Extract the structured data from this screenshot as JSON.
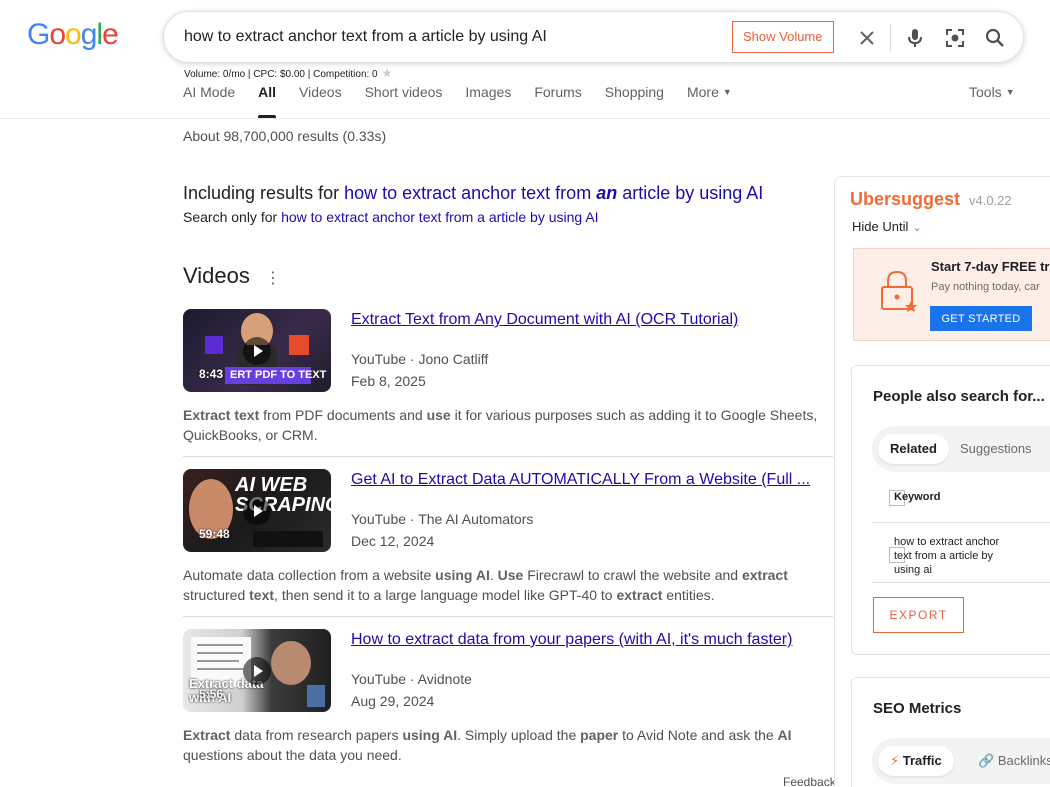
{
  "logo": {
    "letters": [
      "G",
      "o",
      "o",
      "g",
      "l",
      "e"
    ],
    "colors": [
      "#4285f4",
      "#ea4335",
      "#fbbc05",
      "#4285f4",
      "#34a853",
      "#ea4335"
    ]
  },
  "search": {
    "query": "how to extract anchor text from a article by using AI",
    "show_volume_label": "Show Volume",
    "volume_line": "Volume: 0/mo | CPC: $0.00 | Competition: 0",
    "icons": [
      "close-icon",
      "mic-icon",
      "lens-icon",
      "search-icon"
    ]
  },
  "tabs": [
    {
      "label": "AI Mode",
      "active": false
    },
    {
      "label": "All",
      "active": true
    },
    {
      "label": "Videos",
      "active": false
    },
    {
      "label": "Short videos",
      "active": false
    },
    {
      "label": "Images",
      "active": false
    },
    {
      "label": "Forums",
      "active": false
    },
    {
      "label": "Shopping",
      "active": false
    },
    {
      "label": "More",
      "active": false
    }
  ],
  "tools_label": "Tools",
  "stats": "About 98,700,000 results (0.33s)",
  "including": {
    "prefix": "Including results for ",
    "link_before": "how to extract anchor text from ",
    "link_emph": "an",
    "link_after": " article by using AI",
    "search_only_prefix": "Search only for ",
    "search_only_link": "how to extract anchor text from a article by using AI"
  },
  "videos_heading": "Videos",
  "videos": [
    {
      "title": "Extract Text from Any Document with AI (OCR Tutorial)",
      "source": "YouTube · Jono Catliff",
      "date": "Feb 8, 2025",
      "duration": "8:43",
      "thumb_caption": "ERT PDF TO TEXT",
      "desc_parts": [
        {
          "t": "Extract text",
          "b": true
        },
        {
          "t": " from PDF documents and ",
          "b": false
        },
        {
          "t": "use",
          "b": true
        },
        {
          "t": " it for various purposes such as adding it to Google Sheets, QuickBooks, or CRM.",
          "b": false
        }
      ]
    },
    {
      "title": "Get AI to Extract Data AUTOMATICALLY From a Website (Full ...",
      "source": "YouTube · The AI Automators",
      "date": "Dec 12, 2024",
      "duration": "59:48",
      "thumb_caption": "AI WEB SCRAPING",
      "desc_parts": [
        {
          "t": "Automate data collection from a website ",
          "b": false
        },
        {
          "t": "using AI",
          "b": true
        },
        {
          "t": ". ",
          "b": false
        },
        {
          "t": "Use",
          "b": true
        },
        {
          "t": " Firecrawl to crawl the website and ",
          "b": false
        },
        {
          "t": "extract",
          "b": true
        },
        {
          "t": " structured ",
          "b": false
        },
        {
          "t": "text",
          "b": true
        },
        {
          "t": ", then send it to a large language model like GPT-40 to ",
          "b": false
        },
        {
          "t": "extract",
          "b": true
        },
        {
          "t": " entities.",
          "b": false
        }
      ]
    },
    {
      "title": "How to extract data from your papers (with AI, it's much faster)",
      "source": "YouTube · Avidnote",
      "date": "Aug 29, 2024",
      "duration": "5:56",
      "thumb_caption": "Extract data with AI",
      "desc_parts": [
        {
          "t": "Extract",
          "b": true
        },
        {
          "t": " data from research papers ",
          "b": false
        },
        {
          "t": "using AI",
          "b": true
        },
        {
          "t": ". Simply upload the ",
          "b": false
        },
        {
          "t": "paper",
          "b": true
        },
        {
          "t": " to Avid Note and ask the ",
          "b": false
        },
        {
          "t": "AI",
          "b": true
        },
        {
          "t": " questions about the data you need.",
          "b": false
        }
      ]
    }
  ],
  "feedback": "Feedback",
  "ubersuggest": {
    "title": "Ubersuggest",
    "version": "v4.0.22",
    "hide_until": "Hide Until",
    "promo_title": "Start 7-day FREE tr",
    "promo_sub": "Pay nothing today, car",
    "promo_button": "GET STARTED",
    "people_title": "People also search for...",
    "tab_related": "Related",
    "tab_suggestions": "Suggestions",
    "keyword_header": "Keyword",
    "keyword_value": "how to extract anchor text from a article by using ai",
    "export_label": "EXPORT",
    "seo_title": "SEO Metrics",
    "seo_tab_traffic": "Traffic",
    "seo_tab_backlinks": "Backlinks",
    "accent": "#f06c34"
  }
}
